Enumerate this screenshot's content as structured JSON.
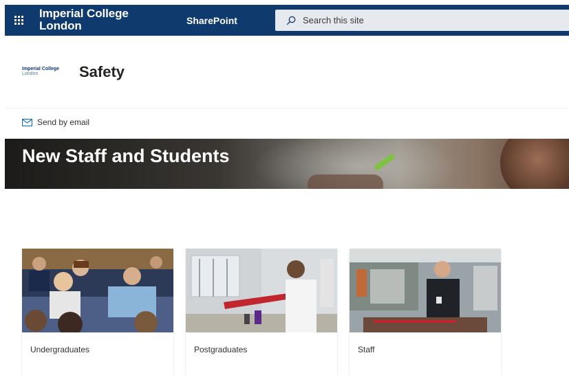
{
  "suite_bar": {
    "org_line1": "Imperial College",
    "org_line2": "London",
    "app_name": "SharePoint",
    "search_placeholder": "Search this site",
    "background_color": "#0f3a6e"
  },
  "site": {
    "logo_line1": "Imperial College",
    "logo_line2": "London",
    "title": "Safety",
    "send_by_email": "Send by email"
  },
  "banner": {
    "title": "New Staff and Students"
  },
  "cards": [
    {
      "label": "Undergraduates",
      "image": "students-in-lecture-hall"
    },
    {
      "label": "Postgraduates",
      "image": "researcher-in-lab"
    },
    {
      "label": "Staff",
      "image": "staff-member-in-workshop"
    }
  ],
  "icons": {
    "waffle": "app-launcher-icon",
    "search": "search-icon",
    "email": "mail-icon"
  }
}
